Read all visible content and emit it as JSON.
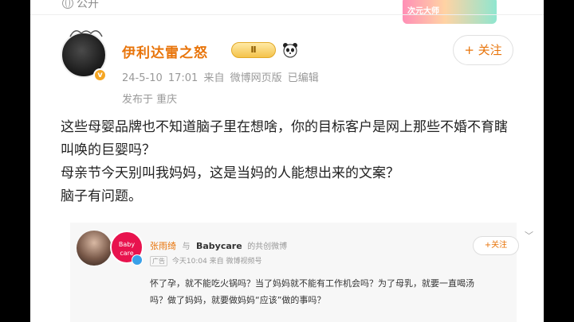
{
  "top": {
    "visibility_label": "公开",
    "sticker_text": "次元大师"
  },
  "post": {
    "username": "伊利达雷之怒",
    "level_badge": "Ⅱ",
    "follow_button": "+ 关注",
    "timestamp": "24-5-10 17:01",
    "source": "来自 微博网页版",
    "edited": "已编辑",
    "location": "发布于 重庆",
    "content": [
      "这些母婴品牌也不知道脑子里在想啥，你的目标客户是网上那些不婚不育瞎叫唤的巨婴吗？",
      "母亲节今天别叫我妈妈，这是当妈的人能想出来的文案？",
      "脑子有问题。"
    ]
  },
  "quoted": {
    "author": "张雨绮",
    "with_word": "与",
    "brand": "Babycare",
    "co_created": "的共创微博",
    "ad_tag": "广告",
    "meta": "今天10:04  来自 微博视频号",
    "brand_avatar_text": "Baby care",
    "follow_button": "+关注",
    "text": "怀了孕，就不能吃火锅吗？当了妈妈就不能有工作机会吗？为了母乳，就要一直喝汤吗？做了妈妈，就要做妈妈“应该”做的事吗？"
  }
}
